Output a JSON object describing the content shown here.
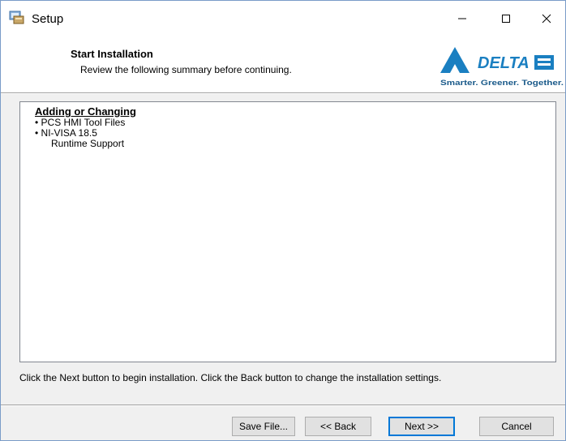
{
  "window": {
    "title": "Setup"
  },
  "titlebar_buttons": {
    "minimize_icon": "minimize-icon",
    "maximize_icon": "maximize-icon",
    "close_icon": "close-icon"
  },
  "header": {
    "title": "Start Installation",
    "subtitle": "Review the following summary before continuing.",
    "logo": {
      "brand": "DELTA",
      "tagline": "Smarter. Greener. Together.",
      "accent": "#1a7fc1"
    }
  },
  "summary": {
    "heading": "Adding or Changing",
    "lines": [
      "• PCS HMI Tool Files",
      "• NI-VISA 18.5",
      "      Runtime Support"
    ]
  },
  "instruction": "Click the Next button to begin installation.  Click the Back button to change the installation settings.",
  "buttons": {
    "save_file": "Save File...",
    "back": "<< Back",
    "next": "Next >>",
    "cancel": "Cancel"
  }
}
